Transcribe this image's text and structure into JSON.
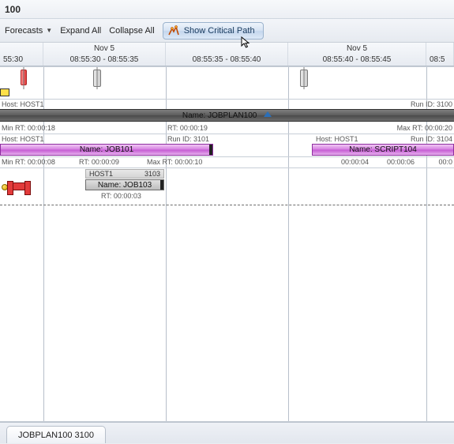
{
  "title": "100",
  "toolbar": {
    "forecasts": "Forecasts",
    "expand": "Expand All",
    "collapse": "Collapse All",
    "critical_path": "Show Critical Path"
  },
  "timeline": {
    "cols": [
      {
        "date": "",
        "range": "55:30",
        "width": 55
      },
      {
        "date": "Nov 5",
        "range": "08:55:30 - 08:55:35",
        "width": 155
      },
      {
        "date": "",
        "range": "08:55:35 - 08:55:40",
        "width": 155
      },
      {
        "date": "Nov 5",
        "range": "08:55:40 - 08:55:45",
        "width": 175
      },
      {
        "date": "",
        "range": "08:5",
        "width": 35
      }
    ]
  },
  "lane0": {
    "host_left": "Host: HOST1",
    "runid_right": "Run ID: 3100"
  },
  "plan": {
    "label": "Name: JOBPLAN100"
  },
  "row_rt": {
    "min_left": "Min RT: 00:00:18",
    "mid": "RT: 00:00:19",
    "max_right": "Max RT: 00:00:20"
  },
  "row_host": {
    "left": "Host: HOST1",
    "mid": "Run ID: 3101",
    "right_host": "Host: HOST1",
    "right_run": "Run ID: 3104"
  },
  "job101": {
    "label": "Name: JOB101"
  },
  "script104": {
    "label": "Name: SCRIPT104"
  },
  "row_rt2": {
    "min": "Min RT: 00:00:08",
    "rt": "RT: 00:00:09",
    "max": "Max RT: 00:00:10",
    "s104_a": "00:00:04",
    "s104_b": "00:00:06",
    "s104_c": "00:0"
  },
  "job103": {
    "sub_host": "HOST1",
    "sub_run": "3103",
    "label": "Name: JOB103",
    "rt": "RT: 00:00:03"
  },
  "tab": {
    "label": "JOBPLAN100 3100"
  }
}
